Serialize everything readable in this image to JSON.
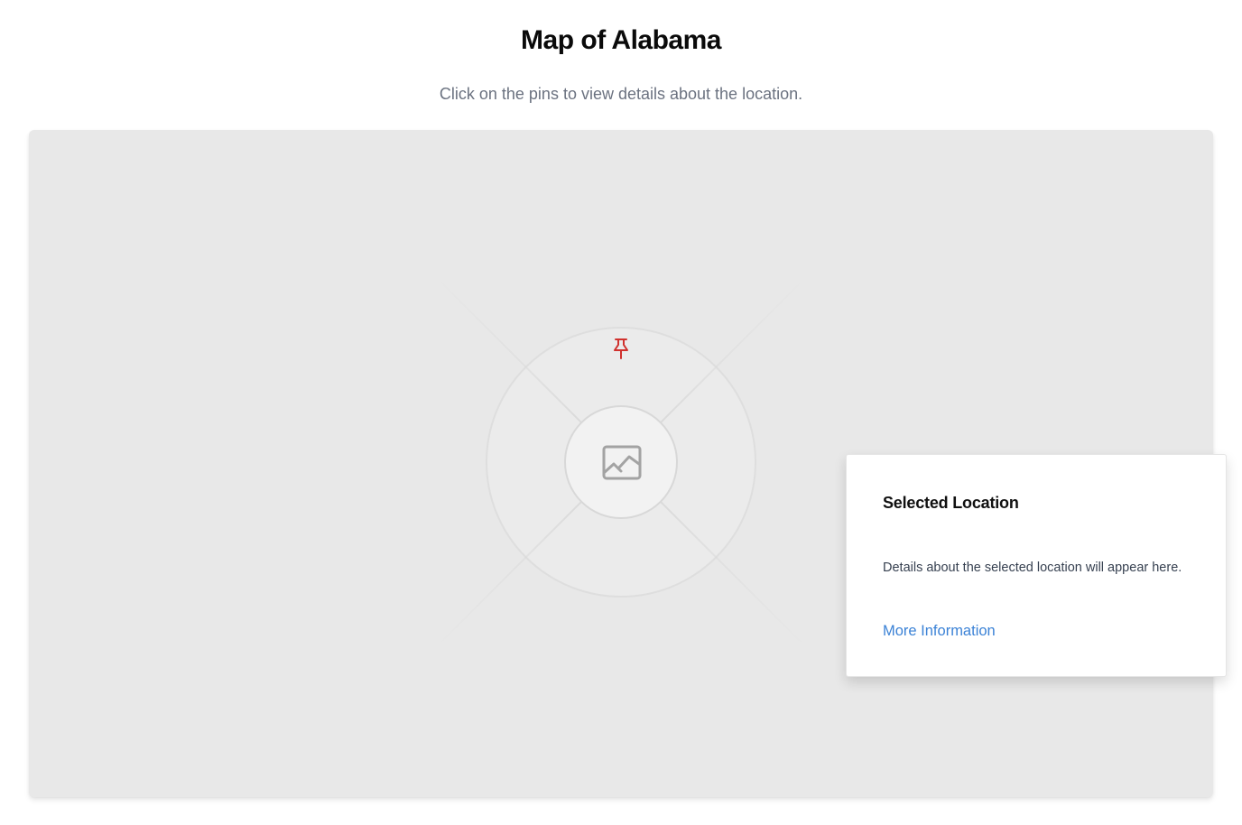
{
  "header": {
    "title": "Map of Alabama",
    "subtitle": "Click on the pins to view details about the location."
  },
  "map": {
    "placeholder_icon": "image-icon",
    "pins": [
      {
        "icon": "pushpin-icon",
        "color": "#d0312d"
      }
    ]
  },
  "selected_location": {
    "title": "Selected Location",
    "details": "Details about the selected location will appear here.",
    "link_label": "More Information"
  },
  "colors": {
    "pin": "#d0312d",
    "link": "#3b82d6",
    "map_background": "#e8e8e8"
  }
}
